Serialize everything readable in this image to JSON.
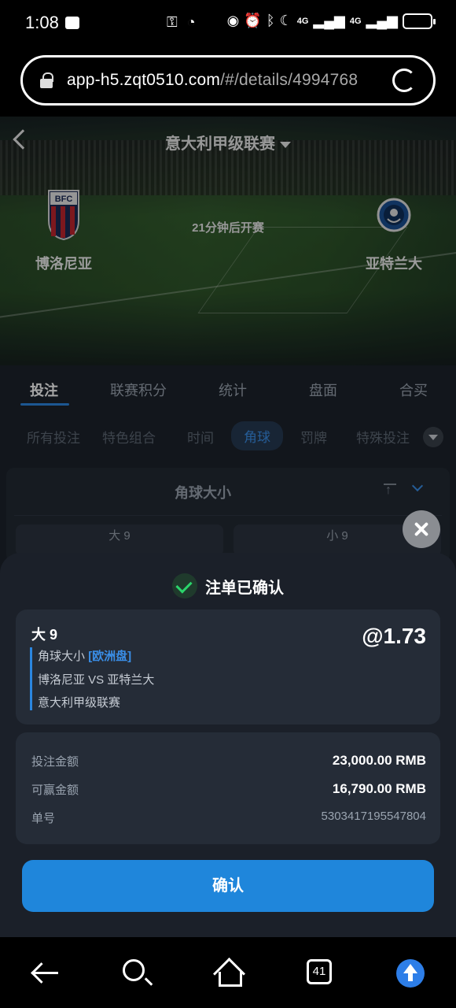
{
  "status_bar": {
    "time": "1:08",
    "network_1": "4G",
    "network_2": "4G",
    "battery_percent": 95
  },
  "browser": {
    "url_host": "app-h5.zqt0510.com",
    "url_path": "/#/details/4994768"
  },
  "match": {
    "league": "意大利甲级联赛",
    "kickoff_text": "21分钟后开赛",
    "home_team": "博洛尼亚",
    "away_team": "亚特兰大"
  },
  "tabs": [
    {
      "label": "投注",
      "active": true
    },
    {
      "label": "联赛积分",
      "active": false
    },
    {
      "label": "统计",
      "active": false
    },
    {
      "label": "盘面",
      "active": false
    },
    {
      "label": "合买",
      "active": false
    }
  ],
  "subtabs": [
    {
      "label": "所有投注",
      "active": false
    },
    {
      "label": "特色组合",
      "active": false
    },
    {
      "label": "时间",
      "active": false
    },
    {
      "label": "角球",
      "active": true
    },
    {
      "label": "罚牌",
      "active": false
    },
    {
      "label": "特殊投注",
      "active": false
    }
  ],
  "market": {
    "title": "角球大小",
    "options": [
      "大 9",
      "小 9"
    ]
  },
  "confirmation": {
    "title": "注单已确认",
    "selection": "大 9",
    "odds": "@1.73",
    "market_name": "角球大小",
    "odds_type": "[欧洲盘]",
    "fixture": "博洛尼亚 VS 亚特兰大",
    "league": "意大利甲级联赛",
    "stake_label": "投注金额",
    "stake_value": "23,000.00 RMB",
    "win_label": "可赢金额",
    "win_value": "16,790.00 RMB",
    "id_label": "单号",
    "id_value": "5303417195547804",
    "confirm_label": "确认"
  },
  "navbar": {
    "tab_count": "41"
  },
  "colors": {
    "accent": "#1f86db",
    "success": "#2bd46b",
    "sheet_bg": "#1b2029"
  }
}
